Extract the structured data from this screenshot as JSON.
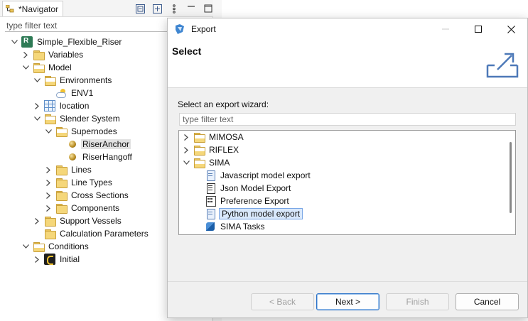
{
  "navigator": {
    "tab_label": "*Navigator",
    "filter_placeholder": "type filter text",
    "tree": [
      {
        "label": "Simple_Flexible_Riser",
        "icon": "riser-app-icon",
        "expanded": true
      },
      {
        "label": "Variables",
        "icon": "folder-icon",
        "expanded": false
      },
      {
        "label": "Model",
        "icon": "folder-open-icon",
        "expanded": true
      },
      {
        "label": "Environments",
        "icon": "folder-open-icon",
        "expanded": true
      },
      {
        "label": "ENV1",
        "icon": "environment-cloud-icon"
      },
      {
        "label": "location",
        "icon": "location-grid-icon",
        "expanded": false
      },
      {
        "label": "Slender System",
        "icon": "folder-open-icon",
        "expanded": true
      },
      {
        "label": "Supernodes",
        "icon": "folder-open-icon",
        "expanded": true
      },
      {
        "label": "RiserAnchor",
        "icon": "supernode-ball-icon",
        "selected": true
      },
      {
        "label": "RiserHangoff",
        "icon": "supernode-ball-icon"
      },
      {
        "label": "Lines",
        "icon": "folder-icon",
        "expanded": false
      },
      {
        "label": "Line Types",
        "icon": "folder-icon",
        "expanded": false
      },
      {
        "label": "Cross Sections",
        "icon": "folder-icon",
        "expanded": false
      },
      {
        "label": "Components",
        "icon": "folder-icon",
        "expanded": false
      },
      {
        "label": "Support Vessels",
        "icon": "folder-icon",
        "expanded": false
      },
      {
        "label": "Calculation Parameters",
        "icon": "folder-icon"
      },
      {
        "label": "Conditions",
        "icon": "folder-open-icon",
        "expanded": true
      },
      {
        "label": "Initial",
        "icon": "initial-condition-icon",
        "expanded": false
      }
    ]
  },
  "dialog": {
    "title": "Export",
    "banner_title": "Select",
    "wizard_label": "Select an export wizard:",
    "filter_placeholder": "type filter text",
    "tree": [
      {
        "label": "MIMOSA",
        "icon": "folder-open-icon",
        "expanded": false
      },
      {
        "label": "RIFLEX",
        "icon": "folder-open-icon",
        "expanded": false
      },
      {
        "label": "SIMA",
        "icon": "folder-open-icon",
        "expanded": true
      },
      {
        "label": "Javascript model export",
        "icon": "document-icon"
      },
      {
        "label": "Json Model Export",
        "icon": "json-document-icon"
      },
      {
        "label": "Preference Export",
        "icon": "preference-icon"
      },
      {
        "label": "Python model export",
        "icon": "document-icon",
        "selected": true
      },
      {
        "label": "SIMA Tasks",
        "icon": "sima-tasks-icon"
      }
    ],
    "buttons": {
      "back": "< Back",
      "next": "Next >",
      "finish": "Finish",
      "cancel": "Cancel"
    }
  },
  "colors": {
    "selection_bg": "#d9e8fb",
    "selection_border": "#7aa7e6",
    "dialog_bg": "#f0f0f0",
    "folder": "#f5d77a"
  }
}
